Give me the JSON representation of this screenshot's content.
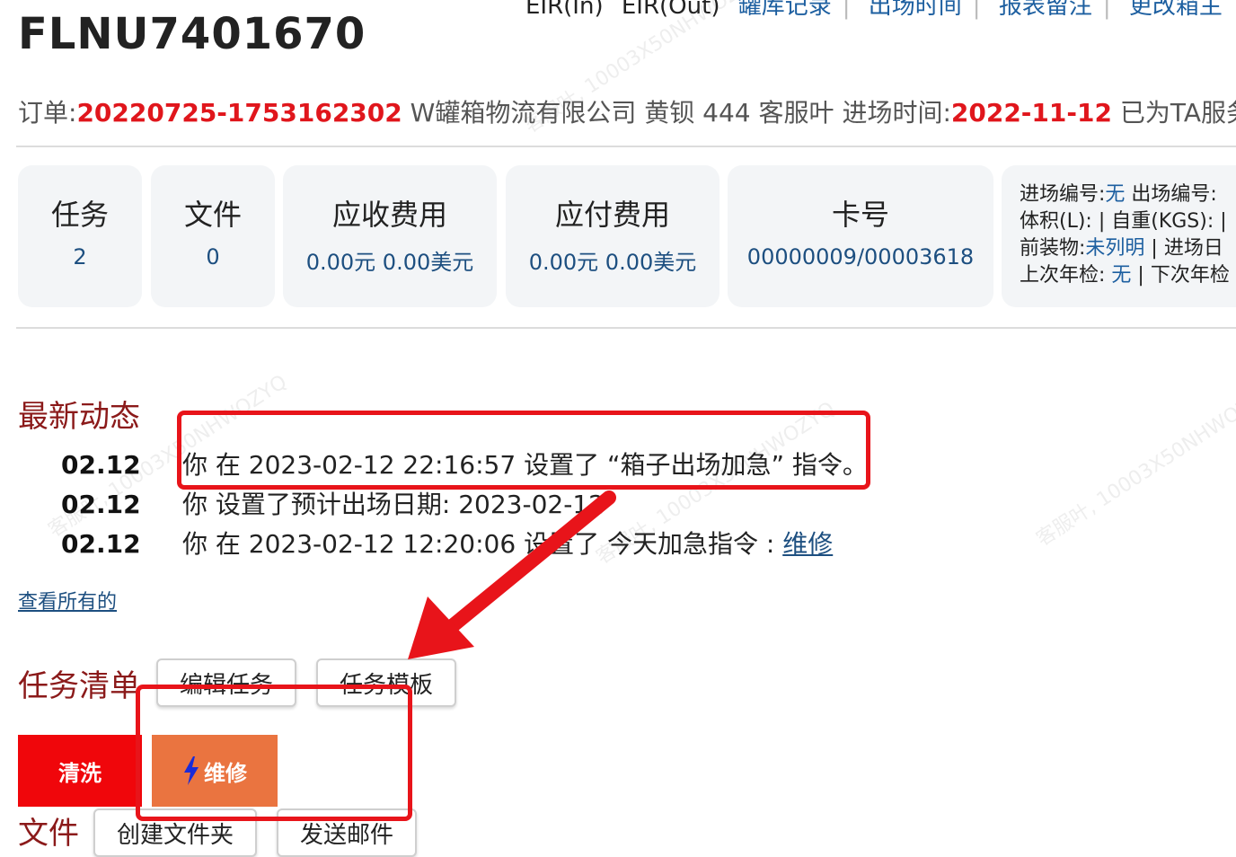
{
  "header": {
    "top_links": [
      "EIR(In)",
      "EIR(Out)",
      "罐库记录",
      "出场时间",
      "报表留注",
      "更改箱主"
    ],
    "title": "FLNU7401670",
    "meta": {
      "order_label": "订单:",
      "order_no": "20220725-1753162302",
      "company": "W罐箱物流有限公司",
      "person": "黄钡 444",
      "service": "客服叶",
      "entry_label": "进场时间:",
      "entry_date": "2022-11-12",
      "served": "已为TA服务"
    }
  },
  "cards": [
    {
      "label": "任务",
      "value": "2"
    },
    {
      "label": "文件",
      "value": "0"
    },
    {
      "label": "应收费用",
      "value": "0.00元 0.00美元"
    },
    {
      "label": "应付费用",
      "value": "0.00元 0.00美元"
    },
    {
      "label": "卡号",
      "value": "00000009/00003618"
    }
  ],
  "info": {
    "line1_label": "进场编号:",
    "line1_value": "无",
    "line1_rest": " 出场编号:",
    "line2": "体积(L): | 自重(KGS): |",
    "line3_label": "前装物:",
    "line3_value": "未列明",
    "line3_rest": " | 进场日",
    "line4_label": "上次年检: ",
    "line4_value": "无",
    "line4_rest": " |  下次年检"
  },
  "activity": {
    "title": "最新动态",
    "items": [
      {
        "date": "02.12",
        "text": "你 在 2023-02-12 22:16:57 设置了 “箱子出场加急” 指令。",
        "link": ""
      },
      {
        "date": "02.12",
        "text": "你 设置了预计出场日期: 2023-02-12",
        "link": ""
      },
      {
        "date": "02.12",
        "text": "你 在 2023-02-12 12:20:06 设置了 今天加急指令 : ",
        "link": "维修"
      }
    ],
    "view_all": "查看所有的"
  },
  "tasks": {
    "title": "任务清单",
    "edit_button": "编辑任务",
    "template_button": "任务模板",
    "items": [
      {
        "label": "清洗",
        "color": "#f0060b"
      },
      {
        "label": "维修",
        "color": "#ea7440",
        "icon": "lightning-icon"
      }
    ]
  },
  "files": {
    "title": "文件",
    "buttons": [
      "创建文件夹",
      "发送邮件"
    ]
  },
  "watermark": "客服叶, 10003X50NHWOZYQ",
  "colors": {
    "accent_red": "#e0161c",
    "link_blue": "#1d4f80",
    "annotation_red": "#e8141a"
  }
}
